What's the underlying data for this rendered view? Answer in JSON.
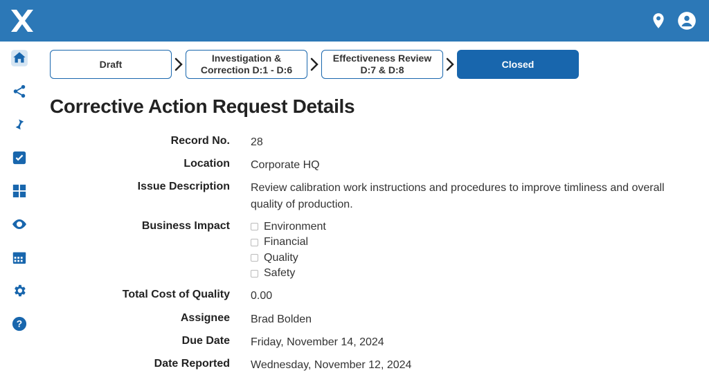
{
  "workflow": {
    "steps": [
      {
        "label": "Draft",
        "active": false
      },
      {
        "label": "Investigation & Correction D:1 - D:6",
        "active": false
      },
      {
        "label": "Effectiveness Review D:7 & D:8",
        "active": false
      },
      {
        "label": "Closed",
        "active": true
      }
    ]
  },
  "page": {
    "title": "Corrective Action Request Details"
  },
  "details": {
    "record_no_label": "Record No.",
    "record_no": "28",
    "location_label": "Location",
    "location": "Corporate HQ",
    "issue_desc_label": "Issue Description",
    "issue_desc": "Review calibration work instructions and procedures to improve timliness and overall quality of production.",
    "business_impact_label": "Business Impact",
    "business_impact": [
      {
        "label": "Environment",
        "checked": false
      },
      {
        "label": "Financial",
        "checked": false
      },
      {
        "label": "Quality",
        "checked": false
      },
      {
        "label": "Safety",
        "checked": false
      }
    ],
    "total_cost_label": "Total Cost of Quality",
    "total_cost": "0.00",
    "assignee_label": "Assignee",
    "assignee": "Brad Bolden",
    "due_date_label": "Due Date",
    "due_date": "Friday, November 14, 2024",
    "date_reported_label": "Date Reported",
    "date_reported": "Wednesday, November 12, 2024"
  }
}
